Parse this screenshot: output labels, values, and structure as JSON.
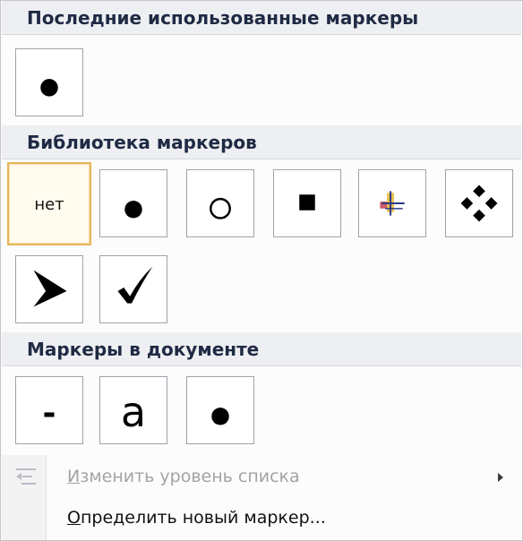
{
  "sections": {
    "recent": {
      "title": "Последние использованные маркеры"
    },
    "library": {
      "title": "Библиотека маркеров"
    },
    "document": {
      "title": "Маркеры в документе"
    }
  },
  "markers": {
    "none_label": "нет",
    "document_letter": "a",
    "document_dash": "-"
  },
  "commands": {
    "change_level": {
      "first_letter": "И",
      "rest": "зменить уровень списка",
      "disabled": true
    },
    "define_new": {
      "first_letter": "О",
      "rest": "пределить новый маркер..."
    }
  },
  "colors": {
    "header_bg": "#eeeff2",
    "header_text": "#1f2a44",
    "selected_border": "#e7b55b",
    "disabled_text": "#a3a3a3"
  }
}
